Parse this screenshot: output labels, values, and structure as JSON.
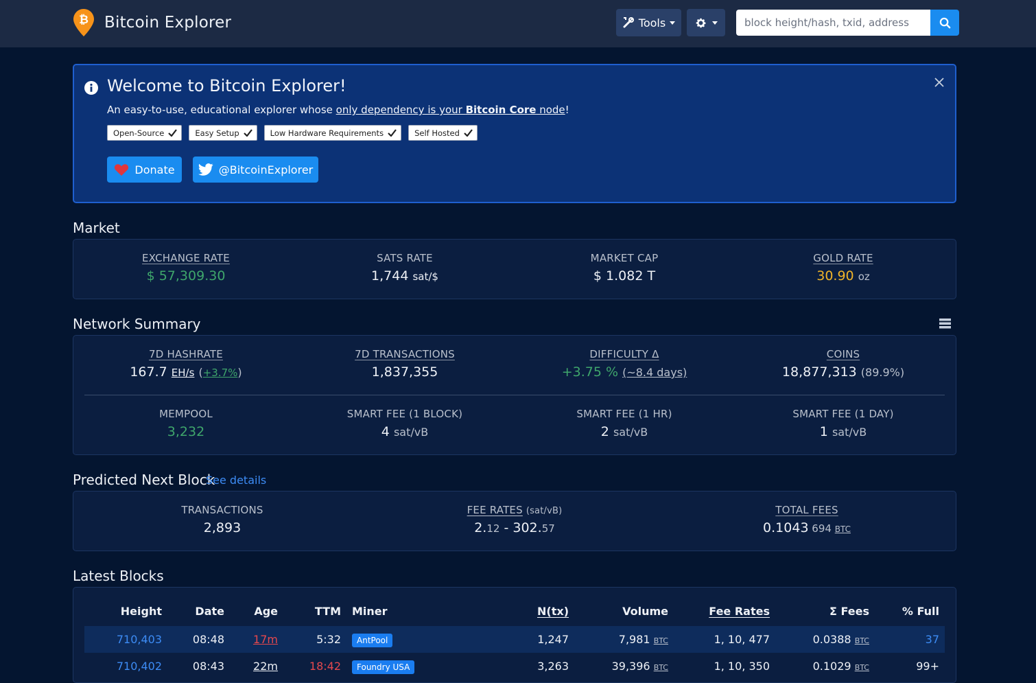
{
  "header": {
    "title": "Bitcoin Explorer",
    "tools_label": "Tools",
    "search_placeholder": "block height/hash, txid, address",
    "brand_color": "#f7931a"
  },
  "welcome": {
    "title": "Welcome to Bitcoin Explorer!",
    "sub_prefix": "An easy-to-use, educational explorer whose ",
    "sub_link1": "only dependency is your ",
    "sub_bold": "Bitcoin Core",
    "sub_link2": " node",
    "sub_suffix": "!",
    "chips": [
      "Open-Source",
      "Easy Setup",
      "Low Hardware Requirements",
      "Self Hosted"
    ],
    "donate_label": "Donate",
    "twitter_label": "@BitcoinExplorer"
  },
  "market": {
    "title": "Market",
    "exchange_label": "EXCHANGE RATE",
    "exchange_value": "$ 57,309.30",
    "sats_label": "SATS RATE",
    "sats_value": "1,744",
    "sats_unit": "sat/$",
    "cap_label": "MARKET CAP",
    "cap_value": "$ 1.082 T",
    "gold_label": "GOLD RATE",
    "gold_value": "30.90",
    "gold_unit": "oz"
  },
  "network": {
    "title": "Network Summary",
    "hashrate_label": "7D HASHRATE",
    "hashrate_value": "167.7",
    "hashrate_unit": "EH/s",
    "hashrate_change_open": "(",
    "hashrate_change": "+3.7%",
    "hashrate_change_close": ")",
    "tx_label": "7D TRANSACTIONS",
    "tx_value": "1,837,355",
    "diff_label": "DIFFICULTY Δ",
    "diff_value": "+3.75 %",
    "diff_eta": "(~8.4 days)",
    "coins_label": "COINS",
    "coins_value": "18,877,313",
    "coins_pct": "(89.9%)",
    "mempool_label": "MEMPOOL",
    "mempool_value": "3,232",
    "fee1_label": "SMART FEE (1 BLOCK)",
    "fee1_value": "4",
    "fee1_unit": "sat/vB",
    "fee2_label": "SMART FEE (1 HR)",
    "fee2_value": "2",
    "fee2_unit": "sat/vB",
    "fee3_label": "SMART FEE (1 DAY)",
    "fee3_value": "1",
    "fee3_unit": "sat/vB"
  },
  "next_block": {
    "title": "Predicted Next Block",
    "see_details": "See details",
    "tx_label": "TRANSACTIONS",
    "tx_value": "2,893",
    "fee_label": "FEE RATES",
    "fee_unit": "(sat/vB)",
    "fee_min_int": "2.",
    "fee_min_dec": "12",
    "fee_sep": " - ",
    "fee_max_int": "302.",
    "fee_max_dec": "57",
    "total_label": "TOTAL FEES",
    "total_value": "0.1043",
    "total_extra": " 694 ",
    "total_unit": "BTC"
  },
  "latest": {
    "title": "Latest Blocks",
    "headers": {
      "height": "Height",
      "date": "Date",
      "age": "Age",
      "ttm": "TTM",
      "miner": "Miner",
      "ntx": "N(tx)",
      "volume": "Volume",
      "fee_rates": "Fee Rates",
      "fees": "Σ Fees",
      "full": "% Full"
    },
    "rows": [
      {
        "height": "710,403",
        "date": "08:48",
        "age": "17m",
        "ttm": "5:32",
        "miner": "AntPool",
        "ntx": "1,247",
        "volume": "7,981",
        "volume_unit": "BTC",
        "fee_rates": "1, 10, 477",
        "fees": "0.0388",
        "fees_unit": "BTC",
        "full": "37"
      },
      {
        "height": "710,402",
        "date": "08:43",
        "age": "22m",
        "ttm": "18:42",
        "miner": "Foundry USA",
        "ntx": "3,263",
        "volume": "39,396",
        "volume_unit": "BTC",
        "fee_rates": "1, 10, 350",
        "fees": "0.1029",
        "fees_unit": "BTC",
        "full": "99+"
      }
    ]
  }
}
